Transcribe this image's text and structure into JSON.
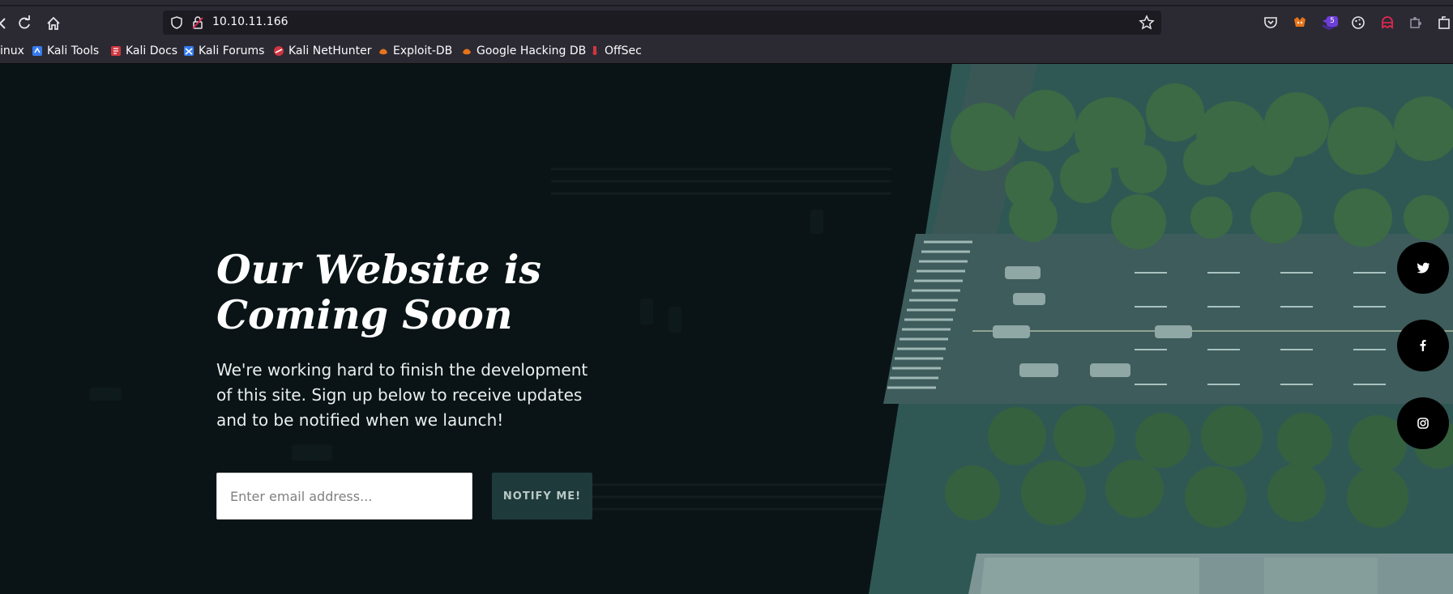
{
  "browser": {
    "url": "10.10.11.166",
    "bookmarks": [
      {
        "label": "inux",
        "icon": "kali-icon",
        "color": "#367bf0"
      },
      {
        "label": "Kali Tools",
        "icon": "kali-tools-icon",
        "color": "#367bf0"
      },
      {
        "label": "Kali Docs",
        "icon": "kali-docs-icon",
        "color": "#d0353f"
      },
      {
        "label": "Kali Forums",
        "icon": "kali-forums-icon",
        "color": "#367bf0"
      },
      {
        "label": "Kali NetHunter",
        "icon": "nethunter-icon",
        "color": "#d0353f"
      },
      {
        "label": "Exploit-DB",
        "icon": "exploit-db-icon",
        "color": "#e8741a"
      },
      {
        "label": "Google Hacking DB",
        "icon": "ghdb-icon",
        "color": "#e8741a"
      },
      {
        "label": "OffSec",
        "icon": "offsec-icon",
        "color": "#d0353f"
      }
    ],
    "extension_badge": "5"
  },
  "hero": {
    "title_line1": "Our Website is",
    "title_line2": "Coming Soon",
    "description": "We're working hard to finish the development of this site. Sign up below to receive updates and to be notified when we launch!",
    "email_placeholder": "Enter email address...",
    "notify_label": "NOTIFY ME!"
  },
  "social": [
    "twitter-icon",
    "facebook-icon",
    "instagram-icon"
  ],
  "colors": {
    "page_bg": "#0a1416",
    "image_tint": "#2e5a58",
    "button_bg": "#1f3a3a"
  }
}
